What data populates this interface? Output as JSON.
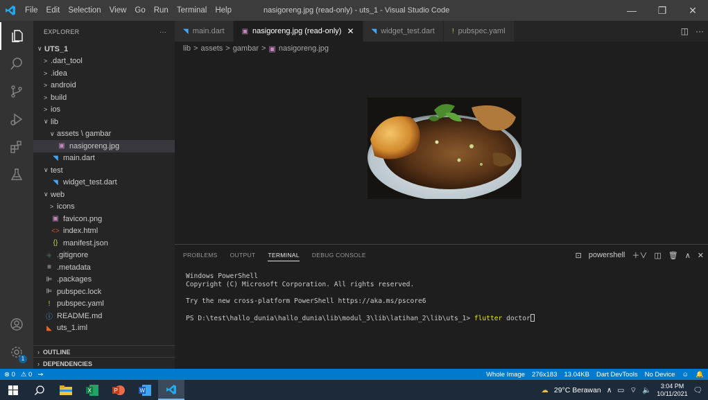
{
  "titlebar": {
    "menu": [
      "File",
      "Edit",
      "Selection",
      "View",
      "Go",
      "Run",
      "Terminal",
      "Help"
    ],
    "title": "nasigoreng.jpg (read-only) - uts_1 - Visual Studio Code"
  },
  "explorer": {
    "header": "EXPLORER",
    "more": "···",
    "tree": [
      {
        "label": "UTS_1",
        "indent": 0,
        "chevron": "∨",
        "icon": "",
        "icon_color": "#cccccc",
        "bold": true
      },
      {
        "label": ".dart_tool",
        "indent": 1,
        "chevron": ">",
        "icon": "",
        "icon_color": "#cccccc"
      },
      {
        "label": ".idea",
        "indent": 1,
        "chevron": ">",
        "icon": "",
        "icon_color": "#cccccc"
      },
      {
        "label": "android",
        "indent": 1,
        "chevron": ">",
        "icon": "",
        "icon_color": "#cccccc"
      },
      {
        "label": "build",
        "indent": 1,
        "chevron": ">",
        "icon": "",
        "icon_color": "#cccccc"
      },
      {
        "label": "ios",
        "indent": 1,
        "chevron": ">",
        "icon": "",
        "icon_color": "#cccccc"
      },
      {
        "label": "lib",
        "indent": 1,
        "chevron": "∨",
        "icon": "",
        "icon_color": "#cccccc"
      },
      {
        "label": "assets \\ gambar",
        "indent": 2,
        "chevron": "∨",
        "icon": "",
        "icon_color": "#cccccc"
      },
      {
        "label": "nasigoreng.jpg",
        "indent": 3,
        "chevron": "",
        "icon": "▣",
        "icon_color": "#c586c0",
        "selected": true
      },
      {
        "label": "main.dart",
        "indent": 2,
        "chevron": "",
        "icon": "◥",
        "icon_color": "#42a5f5"
      },
      {
        "label": "test",
        "indent": 1,
        "chevron": "∨",
        "icon": "",
        "icon_color": "#cccccc"
      },
      {
        "label": "widget_test.dart",
        "indent": 2,
        "chevron": "",
        "icon": "◥",
        "icon_color": "#42a5f5"
      },
      {
        "label": "web",
        "indent": 1,
        "chevron": "∨",
        "icon": "",
        "icon_color": "#cccccc"
      },
      {
        "label": "icons",
        "indent": 2,
        "chevron": ">",
        "icon": "",
        "icon_color": "#cccccc"
      },
      {
        "label": "favicon.png",
        "indent": 2,
        "chevron": "",
        "icon": "▣",
        "icon_color": "#c586c0"
      },
      {
        "label": "index.html",
        "indent": 2,
        "chevron": "",
        "icon": "<>",
        "icon_color": "#e44d26"
      },
      {
        "label": "manifest.json",
        "indent": 2,
        "chevron": "",
        "icon": "{}",
        "icon_color": "#cbcb41"
      },
      {
        "label": ".gitignore",
        "indent": 1,
        "chevron": "",
        "icon": "◈",
        "icon_color": "#41535b"
      },
      {
        "label": ".metadata",
        "indent": 1,
        "chevron": "",
        "icon": "≡",
        "icon_color": "#cccccc"
      },
      {
        "label": ".packages",
        "indent": 1,
        "chevron": "",
        "icon": "⊫",
        "icon_color": "#cccccc"
      },
      {
        "label": "pubspec.lock",
        "indent": 1,
        "chevron": "",
        "icon": "⊫",
        "icon_color": "#cccccc"
      },
      {
        "label": "pubspec.yaml",
        "indent": 1,
        "chevron": "",
        "icon": "!",
        "icon_color": "#cbcb41"
      },
      {
        "label": "README.md",
        "indent": 1,
        "chevron": "",
        "icon": "ⓘ",
        "icon_color": "#42a5f5"
      },
      {
        "label": "uts_1.iml",
        "indent": 1,
        "chevron": "",
        "icon": "◣",
        "icon_color": "#f26522"
      }
    ],
    "outline": "OUTLINE",
    "dependencies": "DEPENDENCIES"
  },
  "tabs": [
    {
      "label": "main.dart",
      "icon": "◥",
      "icon_color": "#42a5f5",
      "active": false
    },
    {
      "label": "nasigoreng.jpg (read-only)",
      "icon": "▣",
      "icon_color": "#c586c0",
      "active": true,
      "close": "✕"
    },
    {
      "label": "widget_test.dart",
      "icon": "◥",
      "icon_color": "#42a5f5",
      "active": false
    },
    {
      "label": "pubspec.yaml",
      "icon": "!",
      "icon_color": "#cbcb41",
      "active": false
    }
  ],
  "tab_actions": {
    "split": "◫",
    "more": "···"
  },
  "breadcrumb": [
    "lib",
    "assets",
    "gambar",
    "nasigoreng.jpg"
  ],
  "breadcrumb_sep": ">",
  "panel": {
    "tabs": [
      "PROBLEMS",
      "OUTPUT",
      "TERMINAL",
      "DEBUG CONSOLE"
    ],
    "active_tab": "TERMINAL",
    "shell": "powershell",
    "terminal": {
      "line1": "Windows PowerShell",
      "line2": "Copyright (C) Microsoft Corporation. All rights reserved.",
      "line3": "Try the new cross-platform PowerShell https://aka.ms/pscore6",
      "prompt": "PS D:\\test\\hallo_dunia\\hallo_dunia\\lib\\modul_3\\lib\\latihan_2\\lib\\uts_1> ",
      "command": "flutter",
      "argument": " doctor"
    }
  },
  "statusbar": {
    "errors": "⊗ 0",
    "warnings": "⚠ 0",
    "right": [
      "Whole Image",
      "276x183",
      "13.04KB",
      "Dart DevTools",
      "No Device"
    ],
    "color": "#007acc"
  },
  "taskbar": {
    "weather": "29°C Berawan",
    "time": "3:04 PM",
    "date": "10/11/2021"
  }
}
